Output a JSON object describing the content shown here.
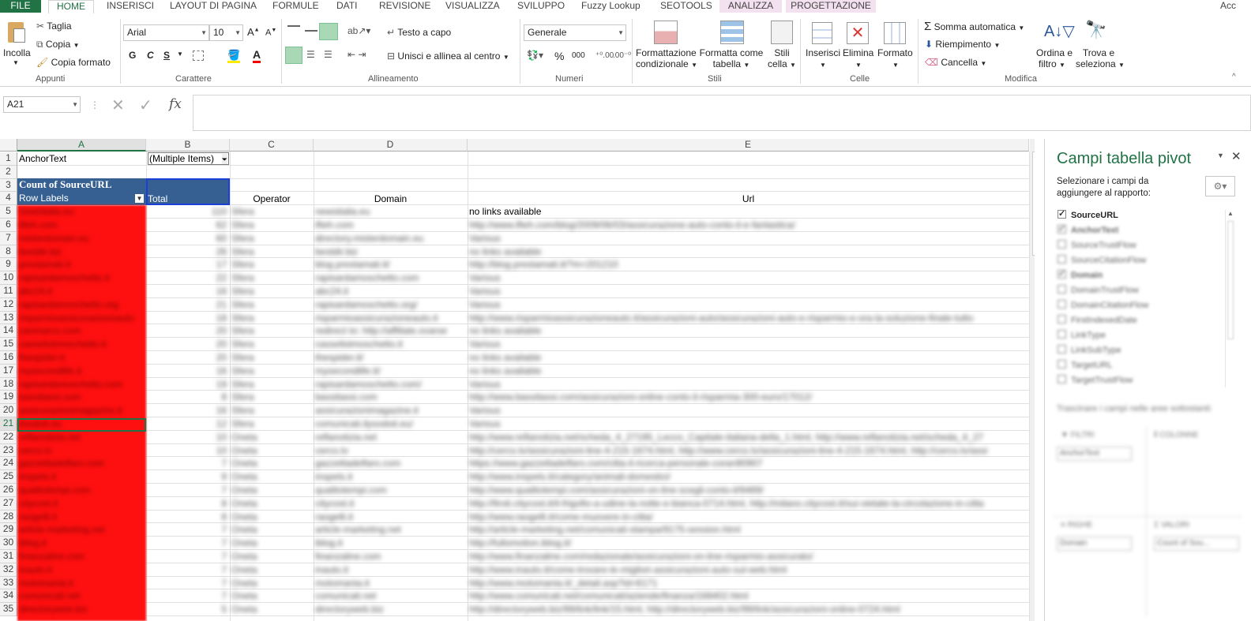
{
  "ribbon_tabs": [
    "FILE",
    "HOME",
    "INSERISCI",
    "LAYOUT DI PAGINA",
    "FORMULE",
    "DATI",
    "REVISIONE",
    "VISUALIZZA",
    "SVILUPPO",
    "Fuzzy Lookup",
    "SEOTOOLS",
    "ANALIZZA",
    "PROGETTAZIONE"
  ],
  "account_label": "Acc",
  "clipboard": {
    "paste": "Incolla",
    "cut": "Taglia",
    "copy": "Copia",
    "format_painter": "Copia formato",
    "group": "Appunti"
  },
  "font": {
    "name": "Arial",
    "size": "10",
    "bold": "G",
    "italic": "C",
    "underline": "S",
    "group": "Carattere"
  },
  "alignment": {
    "wrap": "Testo a capo",
    "merge": "Unisci e allinea al centro",
    "group": "Allineamento"
  },
  "number": {
    "format": "Generale",
    "percent": "%",
    "thousands": "000",
    "group": "Numeri"
  },
  "styles": {
    "conditional": [
      "Formattazione",
      "condizionale"
    ],
    "table": [
      "Formatta come",
      "tabella"
    ],
    "cell": [
      "Stili",
      "cella"
    ],
    "group": "Stili"
  },
  "cells": {
    "insert": "Inserisci",
    "delete": "Elimina",
    "format": "Formato",
    "group": "Celle"
  },
  "editing": {
    "autosum": "Somma automatica",
    "fill": "Riempimento",
    "clear": "Cancella",
    "sort": [
      "Ordina e",
      "filtro"
    ],
    "find": [
      "Trova e",
      "seleziona"
    ],
    "group": "Modifica"
  },
  "formula_bar": {
    "name_box": "A21",
    "fx": "fx",
    "content": ""
  },
  "columns": [
    "A",
    "B",
    "C",
    "D",
    "E"
  ],
  "pivot": {
    "filter_label": "AnchorText",
    "filter_value": "(Multiple Items)",
    "title": "Count of SourceURL",
    "row_labels": "Row Labels",
    "total": "Total",
    "h_operator": "Operator",
    "h_domain": "Domain",
    "h_url": "Url"
  },
  "row_numbers": [
    "1",
    "2",
    "3",
    "4",
    "5",
    "6",
    "7",
    "8",
    "9",
    "10",
    "11",
    "12",
    "13",
    "14",
    "15",
    "16",
    "17",
    "18",
    "19",
    "20",
    "21",
    "22",
    "23",
    "24",
    "25",
    "26",
    "27",
    "28",
    "29",
    "30",
    "31",
    "32",
    "33",
    "34",
    "35"
  ],
  "rows": [
    {
      "a": "newsitalia.eu",
      "b": "110",
      "c": "Sfera",
      "d": "newsitalia.eu",
      "e": "no links available"
    },
    {
      "a": "ifteh.com",
      "b": "62",
      "c": "Sfera",
      "d": "ifteh.com",
      "e": "http://www.ifteh.com/blog/2009/06/03/assicurazione-auto-conto-il-e-fantastica/"
    },
    {
      "a": "misterdomain.eu",
      "b": "60",
      "c": "Sfera",
      "d": "directory.misterdomain.eu",
      "e": "Various"
    },
    {
      "a": "bestdir.biz",
      "b": "26",
      "c": "Sfera",
      "d": "bestdir.biz",
      "e": "no links available"
    },
    {
      "a": "prestamati.it",
      "b": "17",
      "c": "Sfera",
      "d": "blog.prestamati.it/",
      "e": "http://blog.prestamati.it/?m=201210"
    },
    {
      "a": "rapisardamoschetto.it",
      "b": "22",
      "c": "Sfera",
      "d": "rapisardamoschetto.com",
      "e": "Various"
    },
    {
      "a": "abc24.it",
      "b": "16",
      "c": "Sfera",
      "d": "abc24.it",
      "e": "Various"
    },
    {
      "a": "rapisardamoschetto.org",
      "b": "21",
      "c": "Sfera",
      "d": "rapisardamoschetto.org/",
      "e": "Various"
    },
    {
      "a": "risparmioassicurazioneauto",
      "b": "18",
      "c": "Sfera",
      "d": "risparmioassicurazioneauto.it",
      "e": "http://www.risparmioassicurazioneauto.it/assicurazioni-auto/assicurazioni-auto-e-risparmio-e-ora-la-soluzione-finale-tutto"
    },
    {
      "a": "zanmarco.com",
      "b": "20",
      "c": "Sfera",
      "d": "redirect to: http://affiliate.ovarse",
      "e": "no links available"
    },
    {
      "a": "casselistmoschetto.it",
      "b": "20",
      "c": "Sfera",
      "d": "casselistmoschetto.it",
      "e": "Various"
    },
    {
      "a": "thespider.it",
      "b": "20",
      "c": "Sfera",
      "d": "thespider.it/",
      "e": "no links available"
    },
    {
      "a": "mysecondlife.it",
      "b": "16",
      "c": "Sfera",
      "d": "mysecondlife.it/",
      "e": "no links available"
    },
    {
      "a": "rapisardamoschetto.com",
      "b": "19",
      "c": "Sfera",
      "d": "rapisardamoschetto.com/",
      "e": "Various"
    },
    {
      "a": "bassitassi.com",
      "b": "8",
      "c": "Sfera",
      "d": "bassitassi.com",
      "e": "http://www.bassitassi.com/assicurazioni-online-conto-il-risparmia-300-euro/17012/"
    },
    {
      "a": "assicurazionimagazine.it",
      "b": "16",
      "c": "Sfera",
      "d": "assicurazionimagazine.it",
      "e": "Various"
    },
    {
      "a": "ilsodoit.eu",
      "b": "12",
      "c": "Sfera",
      "d": "comunicati.ilysodoit.eu/",
      "e": "Various"
    },
    {
      "a": "reflanotizia.net",
      "b": "10",
      "c": "Oneta",
      "d": "reflanotizia.net",
      "e": "http://www.reflanotizia.net/scheda_4_27195_Lecco_Capitale-italiana-della_1.html, http://www.reflanotizia.net/scheda_4_27"
    },
    {
      "a": "cerco.tv",
      "b": "10",
      "c": "Oneta",
      "d": "cerco.tv",
      "e": "http://cerco.tv/assicurazioni-line-4-215-1674.html, http://www.cerco.tv/assicurazioni-line-4-215-1674.html, http://cerco.tv/assi"
    },
    {
      "a": "gazzettadelfaro.com",
      "b": "7",
      "c": "Oneta",
      "d": "gazzettadelfaro.com",
      "e": "https://www.gazzettadelfaro.com/citta-il-ricerca-personale-coran90907"
    },
    {
      "a": "inspets.it",
      "b": "9",
      "c": "Oneta",
      "d": "inspets.it",
      "e": "http://www.inspets.it/category/animali-domestici/"
    },
    {
      "a": "qualitotempi.com",
      "b": "7",
      "c": "Oneta",
      "d": "qualitotempi.com",
      "e": "http://www.qualitotempi.com/assicurazioni-on-line-scegli-conto-il/9489/"
    },
    {
      "a": "citycost.it",
      "b": "8",
      "c": "Oneta",
      "d": "citycost.it",
      "e": "http://firoti.citycost.it/il-frigofio-a-udine-la-notte-e-bianca-0714.html, http://milano.citycost.it/sui-vietate-la-circolazione-in-citta"
    },
    {
      "a": "raogelli.it",
      "b": "8",
      "c": "Oneta",
      "d": "raogelli.it",
      "e": "http://www.raogelli.it/come-muovere-in-citta/"
    },
    {
      "a": "article-marketing.net",
      "b": "7",
      "c": "Oneta",
      "d": "article-marketing.net",
      "e": "http://article-marketing.net/comunicati-stampa/9175-session.html"
    },
    {
      "a": "iblog.it",
      "b": "7",
      "c": "Oneta",
      "d": "iblog.it",
      "e": "http://fullomotion.iblog.it/"
    },
    {
      "a": "finanzaline.com",
      "b": "7",
      "c": "Oneta",
      "d": "finanzaline.com",
      "e": "http://www.finanzaline.com/redazionale/assicurazioni-on-line-risparmio-assicurato/"
    },
    {
      "a": "inauto.it",
      "b": "7",
      "c": "Oneta",
      "d": "inauto.it",
      "e": "http://www.inauto.it/come-trovare-le-migliori-assicurazioni-auto-sul-web.html"
    },
    {
      "a": "motomania.it",
      "b": "7",
      "c": "Oneta",
      "d": "motomania.it",
      "e": "http://www.motomania.it/_detail.asp?id=6171"
    },
    {
      "a": "comunicati.net",
      "b": "7",
      "c": "Oneta",
      "d": "comunicati.net",
      "e": "http://www.comunicati.net/comunicati/aziende/finanza/168402.html"
    },
    {
      "a": "directoryweb.biz",
      "b": "5",
      "c": "Oneta",
      "d": "directoryweb.biz",
      "e": "http://directoryweb.biz/99/link/link/15.html, http://directoryweb.biz/99/link/assicurazioni-online-0724.html"
    }
  ],
  "pane": {
    "title": "Campi tabella pivot",
    "subtitle": [
      "Selezionare i campi da",
      "aggiungere al rapporto:"
    ],
    "fields": [
      {
        "name": "SourceURL",
        "checked": true
      },
      {
        "name": "AnchorText",
        "checked": true
      },
      {
        "name": "SourceTrustFlow",
        "checked": false
      },
      {
        "name": "SourceCitationFlow",
        "checked": false
      },
      {
        "name": "Domain",
        "checked": true
      },
      {
        "name": "DomainTrustFlow",
        "checked": false
      },
      {
        "name": "DomainCitationFlow",
        "checked": false
      },
      {
        "name": "FirstIndexedDate",
        "checked": false
      },
      {
        "name": "LinkType",
        "checked": false
      },
      {
        "name": "LinkSubType",
        "checked": false
      },
      {
        "name": "TargetURL",
        "checked": false
      },
      {
        "name": "TargetTrustFlow",
        "checked": false
      }
    ],
    "drag_hint": "Trascinare i campi nelle aree sottostanti:",
    "areas": {
      "filters": "FILTRI",
      "columns": "COLONNE",
      "rows": "RIGHE",
      "values": "VALORI"
    },
    "filter_item": "AnchorText",
    "rows_item": "Domain",
    "values_item": "Count of Sou..."
  },
  "colors": {
    "excel_green": "#217346",
    "pivot_header": "#366092",
    "anchor_red": "#ff0000"
  }
}
